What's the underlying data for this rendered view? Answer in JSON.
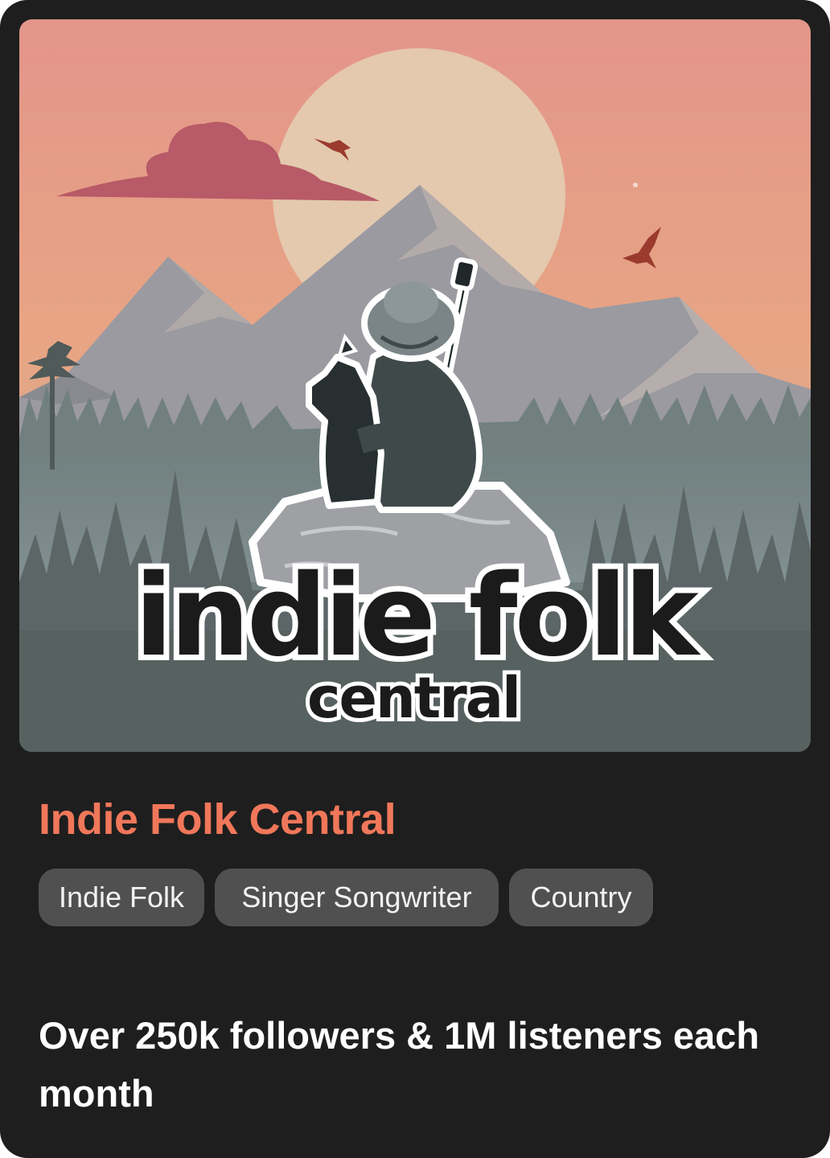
{
  "card": {
    "title": "Indie Folk Central",
    "tags": [
      "Indie Folk",
      "Singer Songwriter",
      "Country"
    ],
    "description": "Over 250k followers & 1M listeners each month"
  },
  "cover": {
    "logo_line1": "indie folk",
    "logo_line2": "central",
    "icons": [
      "mountain-scene",
      "sun",
      "cloud",
      "bird-icon",
      "guitar-icon",
      "dog-silhouette",
      "person-silhouette"
    ]
  },
  "colors": {
    "card_bg": "#1e1e1e",
    "title": "#f0775a",
    "tag_bg": "#505050",
    "tag_text": "#f2f2f2",
    "sky_top": "#e39585",
    "sun": "#e4c9ae"
  }
}
